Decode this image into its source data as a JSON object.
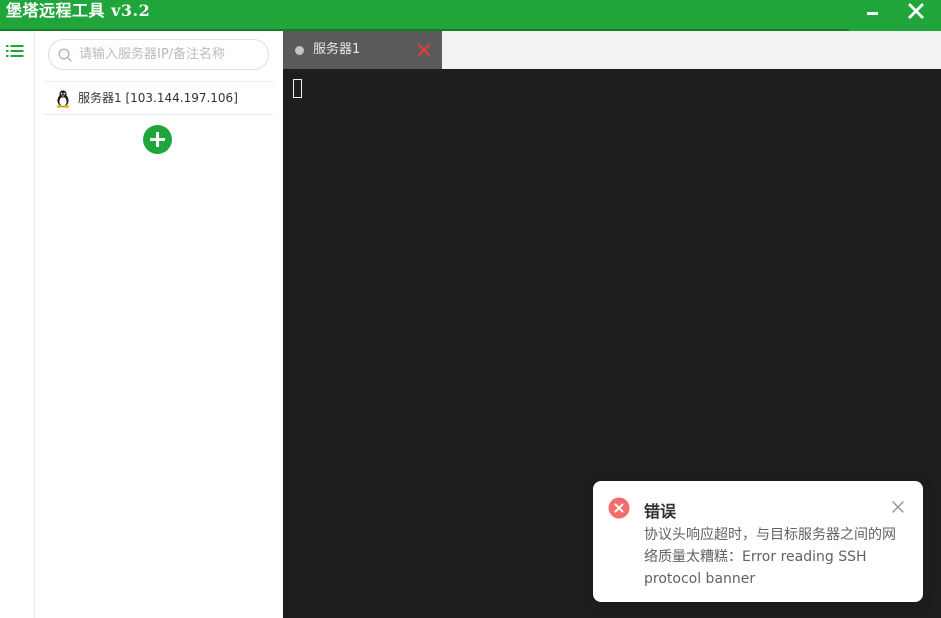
{
  "app": {
    "title": "堡塔远程工具 v3.2"
  },
  "colors": {
    "brand": "#20a53a",
    "terminal_bg": "#1e1e1e",
    "error": "#f56c6c"
  },
  "window_controls": {
    "minimize_icon": "minimize-icon",
    "close_icon": "close-icon"
  },
  "sidebar": {
    "menu_icon": "list-menu-icon"
  },
  "server_panel": {
    "search": {
      "placeholder": "请输入服务器IP/备注名称",
      "value": ""
    },
    "servers": [
      {
        "label": "服务器1 [103.144.197.106]",
        "os_icon": "linux-tux-icon"
      }
    ],
    "add_icon": "plus-circle-icon"
  },
  "tabs": [
    {
      "label": "服务器1",
      "status": "disconnected"
    }
  ],
  "terminal": {
    "cursor": "block"
  },
  "notification": {
    "title": "错误",
    "message": "协议头响应超时，与目标服务器之间的网络质量太糟糕：Error reading SSH protocol banner",
    "icon": "error-circle-icon"
  }
}
